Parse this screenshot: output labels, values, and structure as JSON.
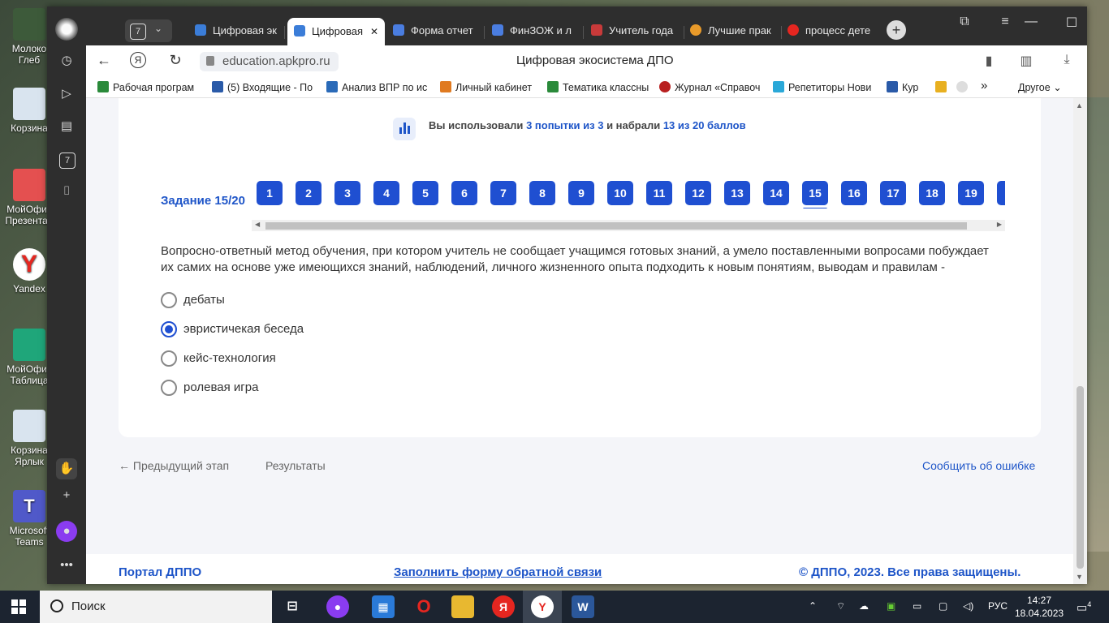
{
  "desktop": {
    "icons": [
      {
        "label": "Молоко\nГлеб",
        "color": "#3d5a3a"
      },
      {
        "label": "Корзина",
        "color": "#d9e4ef"
      },
      {
        "label": "МойОфис\nПрезентац",
        "color": "#e45050"
      },
      {
        "label": "Yandex",
        "color": "#e52620"
      },
      {
        "label": "МойОфис\nТаблица",
        "color": "#1fa67a"
      },
      {
        "label": "Корзина\nЯрлык",
        "color": "#d9e4ef"
      },
      {
        "label": "Microsoft\nTeams",
        "color": "#5059c9"
      }
    ]
  },
  "browser": {
    "tab_counter": "7",
    "tabs": [
      {
        "label": "Цифровая эк",
        "color": "#3b7dd8"
      },
      {
        "label": "Цифровая",
        "color": "#3b7dd8",
        "active": true,
        "close": "✕"
      },
      {
        "label": "Форма отчет",
        "color": "#4a7de0"
      },
      {
        "label": "ФинЗОЖ и л",
        "color": "#4a7de0"
      },
      {
        "label": "Учитель года",
        "color": "#c83a3a"
      },
      {
        "label": "Лучшие прак",
        "color": "#e89a2a"
      },
      {
        "label": "процесс дете",
        "color": "#e52620"
      }
    ],
    "url": "education.apkpro.ru",
    "page_title": "Цифровая экосистема ДПО",
    "bookmarks": [
      {
        "label": "Рабочая програм",
        "color": "#2a8a3a"
      },
      {
        "label": "(5) Входящие - По",
        "color": "#2a5aa8"
      },
      {
        "label": "Анализ ВПР по ис",
        "color": "#2a6ab8"
      },
      {
        "label": "Личный кабинет",
        "color": "#e07a20"
      },
      {
        "label": "Тематика классны",
        "color": "#2a8a3a"
      },
      {
        "label": "Журнал «Справоч",
        "color": "#b82020"
      },
      {
        "label": "Репетиторы Нови",
        "color": "#2aa8d8"
      },
      {
        "label": "Кур",
        "color": "#2a5aa8"
      }
    ],
    "bookmarks_more": "»",
    "bookmarks_other": "Другое"
  },
  "page": {
    "attempts_prefix": "Вы использовали",
    "attempts_used": "3 попытки из 3",
    "attempts_middle": "и набрали",
    "score": "13 из 20 баллов",
    "task_label": "Задание 15/20",
    "question_numbers": [
      "1",
      "2",
      "3",
      "4",
      "5",
      "6",
      "7",
      "8",
      "9",
      "10",
      "11",
      "12",
      "13",
      "14",
      "15",
      "16",
      "17",
      "18",
      "19"
    ],
    "current_question": "15",
    "question_text": "Вопросно-ответный метод обучения, при котором учитель не сообщает учащимся готовых знаний, а умело поставленными вопросами побуждает их самих на основе уже имеющихся знаний, наблюдений, личного жизненного опыта подходить к новым понятиям, выводам и правилам -",
    "options": [
      {
        "label": "дебаты",
        "selected": false
      },
      {
        "label": "эвристичекая беседа",
        "selected": true
      },
      {
        "label": "кейс-технология",
        "selected": false
      },
      {
        "label": "ролевая игра",
        "selected": false
      }
    ],
    "prev_stage": "← Предыдущий этап",
    "results": "Результаты",
    "report_error": "Сообщить об ошибке",
    "footer_portal": "Портал ДППО",
    "footer_feedback": "Заполнить форму обратной связи",
    "footer_copyright": "© ДППО, 2023. Все права защищены."
  },
  "taskbar": {
    "search_placeholder": "Поиск",
    "lang": "РУС",
    "time": "14:27",
    "date": "18.04.2023",
    "notifications": "4"
  }
}
